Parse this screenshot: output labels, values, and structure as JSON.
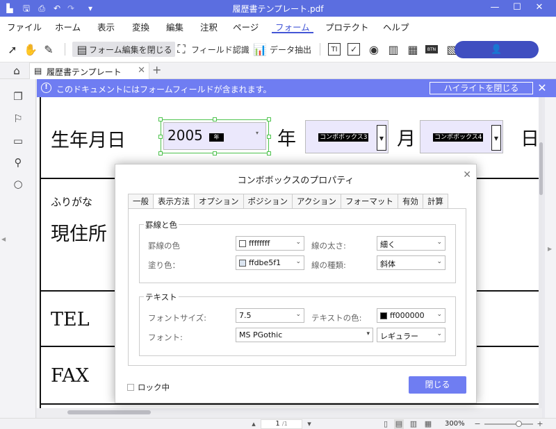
{
  "window": {
    "title": "履歴書テンプレート.pdf"
  },
  "menu": {
    "items": [
      "ファイル",
      "ホーム",
      "表示",
      "変換",
      "編集",
      "注釈",
      "ページ",
      "フォーム",
      "プロテクト",
      "ヘルプ"
    ],
    "active": "フォーム"
  },
  "toolbar": {
    "close_form_edit": "フォーム編集を閉じる",
    "field_recognition": "フィールド認識",
    "data_extract": "データ抽出"
  },
  "tabs": {
    "doc_tab": "履歴書テンプレート"
  },
  "notice": {
    "text": "このドキュメントにはフォームフィールドが含まれます。",
    "highlight_button": "ハイライトを閉じる"
  },
  "document": {
    "birthdate_label": "生年月日",
    "year_unit": "年",
    "month_unit": "月",
    "day_unit": "日",
    "year_value": "2005",
    "year_tag": "年",
    "combo3": "コンボボックス3",
    "combo4": "コンボボックス4",
    "furigana_label": "ふりがな",
    "address_label": "現住所",
    "tel_label": "TEL",
    "fax_label": "FAX"
  },
  "dialog": {
    "title": "コンボボックスのプロパティ",
    "tabs": [
      "一般",
      "表示方法",
      "オプション",
      "ポジション",
      "アクション",
      "フォーマット",
      "有効",
      "計算"
    ],
    "active_tab": "表示方法",
    "border_group": {
      "title": "罫線と色",
      "border_color_label": "罫線の色",
      "border_color_value": "ffffffff",
      "fill_color_label": "塗り色：",
      "fill_color_value": "ffdbe5f1",
      "line_width_label": "線の太さ:",
      "line_width_value": "細く",
      "line_style_label": "線の種類:",
      "line_style_value": "斜体"
    },
    "text_group": {
      "title": "テキスト",
      "font_size_label": "フォントサイズ:",
      "font_size_value": "7.5",
      "text_color_label": "テキストの色:",
      "text_color_value": "ff000000",
      "font_label": "フォント:",
      "font_value": "MS PGothic",
      "style_value": "レギュラー"
    },
    "lock_label": "ロック中",
    "close_button": "閉じる"
  },
  "statusbar": {
    "page_current": "1",
    "page_total": "/1",
    "zoom": "300%"
  },
  "colors": {
    "accent": "#5b6ee0",
    "notice": "#6f7df2",
    "field_fill": "#ebe8fc",
    "selection": "#4cc34c"
  }
}
